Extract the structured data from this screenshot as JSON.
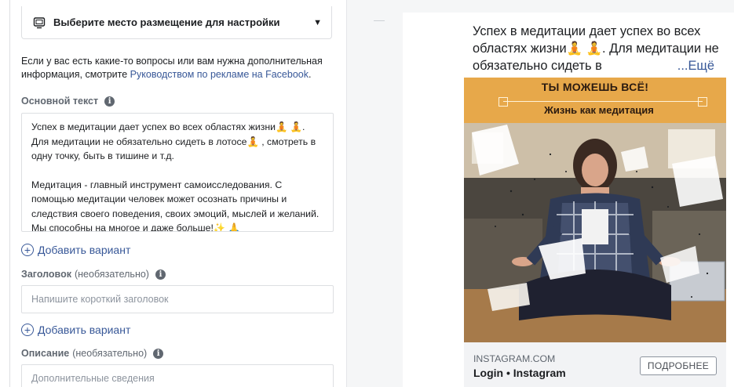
{
  "placement": {
    "label": "Выберите место размещение для настройки",
    "icon": "monitor-icon"
  },
  "help": {
    "text": "Если у вас есть какие-то вопросы или вам нужна дополнительная информация, смотрите ",
    "link": "Руководством по рекламе на Facebook",
    "after": "."
  },
  "primary_text": {
    "label": "Основной текст",
    "paragraph1": "Успех в медитации дает успех во всех областях жизни🧘 🧘. Для медитации не обязательно сидеть в лотосе🧘 , смотреть в одну точку, быть в тишине и т.д.",
    "paragraph2": "Медитация - главный инструмент самоисследования. С помощью медитации человек может осознать причины и следствия своего поведения, своих эмоций, мыслей и желаний. Мы способны на многое и даже больше!✨ 🙏"
  },
  "add_variant_label": "Добавить вариант",
  "headline": {
    "label": "Заголовок",
    "optional": "(необязательно)",
    "placeholder": "Напишите короткий заголовок"
  },
  "description": {
    "label": "Описание",
    "optional": "(необязательно)",
    "placeholder": "Дополнительные сведения"
  },
  "preview": {
    "text": "Успех в медитации дает успех во всех областях жизни🧘 🧘. Для медитации не обязательно сидеть в",
    "more": "...Ещё",
    "banner_line1": "ТЫ МОЖЕШЬ ВСЁ!",
    "banner_line2": "Жизнь как медитация",
    "domain": "INSTAGRAM.COM",
    "title": "Login • Instagram",
    "cta": "ПОДРОБНЕЕ"
  },
  "colors": {
    "link": "#385898",
    "banner": "#e7a84a",
    "border": "#dddfe2"
  }
}
